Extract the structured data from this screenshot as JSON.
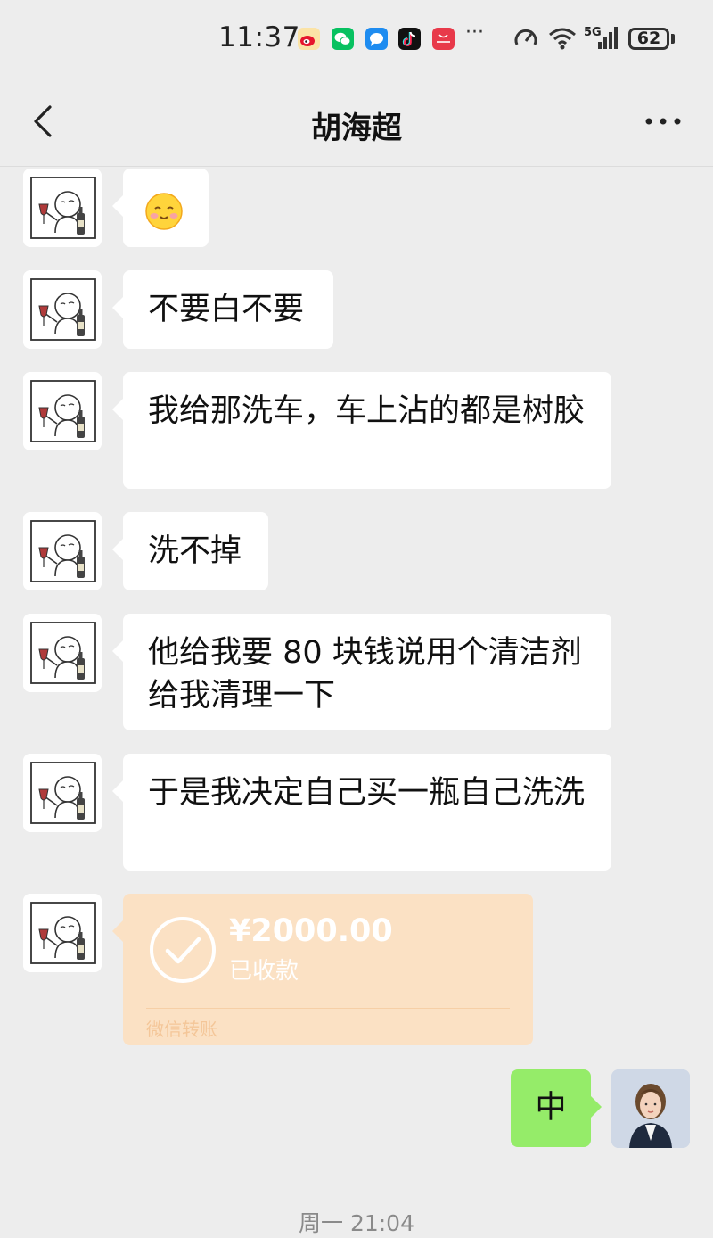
{
  "status_bar": {
    "time": "11:37",
    "overflow": "···",
    "network": "5G",
    "battery": "62",
    "apps": [
      "weibo-icon",
      "wechat-icon",
      "messages-icon",
      "tiktok-icon",
      "huawei-store-icon"
    ]
  },
  "header": {
    "title": "胡海超",
    "back_icon": "chevron-left-icon",
    "more_icon": "more-dots-icon"
  },
  "messages": [
    {
      "sender": "contact",
      "type": "emoji",
      "icon": "smiling-face-icon"
    },
    {
      "sender": "contact",
      "type": "text",
      "text": "不要白不要"
    },
    {
      "sender": "contact",
      "type": "text",
      "text": "我给那洗车，车上沾的都是树胶"
    },
    {
      "sender": "contact",
      "type": "text",
      "text": "洗不掉"
    },
    {
      "sender": "contact",
      "type": "text",
      "text": "他给我要 80 块钱说用个清洁剂给我清理一下"
    },
    {
      "sender": "contact",
      "type": "text",
      "text": "于是我决定自己买一瓶自己洗洗"
    },
    {
      "sender": "contact",
      "type": "transfer",
      "amount": "¥2000.00",
      "status": "已收款",
      "label": "微信转账"
    },
    {
      "sender": "self",
      "type": "text",
      "text": "中"
    }
  ],
  "timestamp": "周一 21:04",
  "colors": {
    "background": "#ededed",
    "self_bubble": "#95ec69",
    "transfer_bg": "#fbe1c4"
  }
}
